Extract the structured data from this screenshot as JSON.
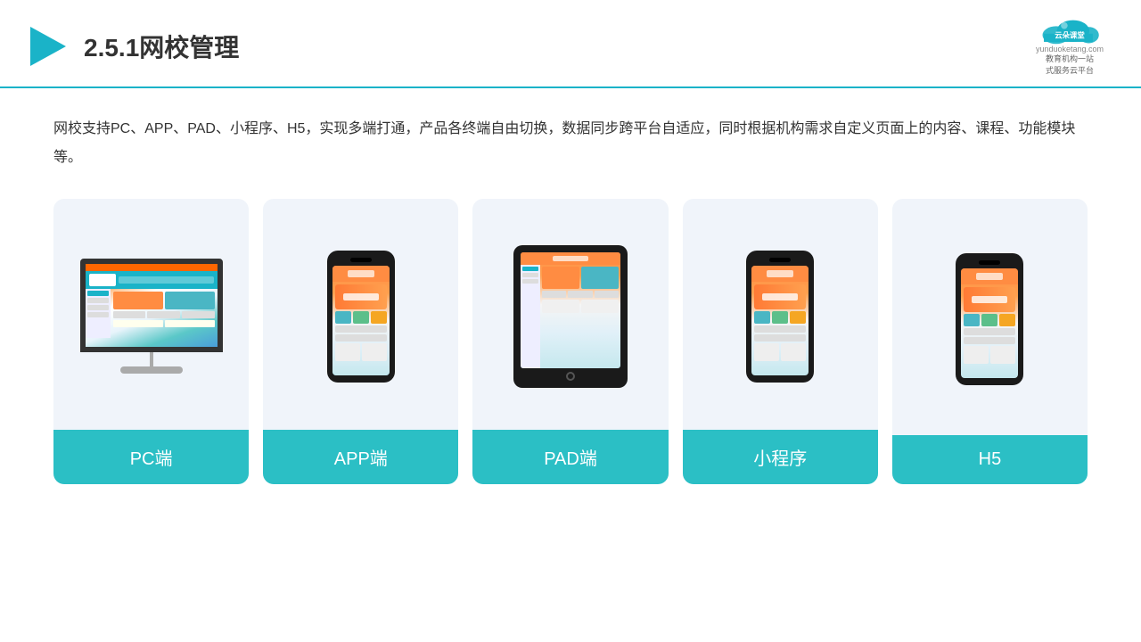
{
  "header": {
    "section_number": "2.5.1",
    "title": "网校管理",
    "logo_name": "云朵课堂",
    "logo_tagline_line1": "教育机构一站",
    "logo_tagline_line2": "式服务云平台",
    "logo_url": "yunduoketang.com"
  },
  "description": "网校支持PC、APP、PAD、小程序、H5，实现多端打通，产品各终端自由切换，数据同步跨平台自适应，同时根据机构需求自定义页面上的内容、课程、功能模块等。",
  "cards": [
    {
      "id": "pc",
      "label": "PC端",
      "type": "monitor"
    },
    {
      "id": "app",
      "label": "APP端",
      "type": "phone"
    },
    {
      "id": "pad",
      "label": "PAD端",
      "type": "tablet"
    },
    {
      "id": "mini",
      "label": "小程序",
      "type": "phone"
    },
    {
      "id": "h5",
      "label": "H5",
      "type": "phone"
    }
  ],
  "brand_color": "#2bbfc5",
  "accent_orange": "#ff7a35"
}
